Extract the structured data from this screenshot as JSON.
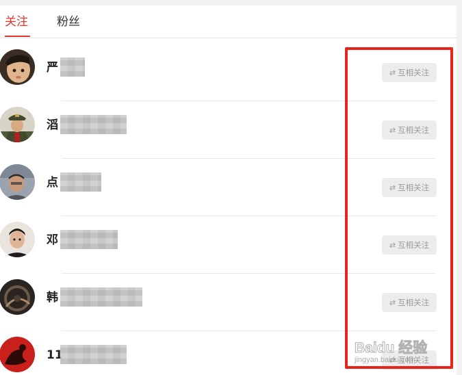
{
  "tabs": {
    "following": "关注",
    "fans": "粉丝",
    "active": "following"
  },
  "users": [
    {
      "name": "严",
      "button": "互相关注"
    },
    {
      "name": "滔",
      "button": "互相关注"
    },
    {
      "name": "点",
      "button": "互相关注"
    },
    {
      "name": "邓",
      "button": "互相关注"
    },
    {
      "name": "韩",
      "button": "互相关注"
    },
    {
      "name": "11",
      "button": "互相关注"
    }
  ],
  "icons": {
    "mutual": "⇄"
  },
  "colors": {
    "accent": "#e0362c",
    "highlight": "#e8221d",
    "button_bg": "#ececec",
    "button_text": "#9a9a9a"
  },
  "watermark": {
    "main": "Baidu 经验",
    "sub": "jingyan.baidu.com"
  }
}
